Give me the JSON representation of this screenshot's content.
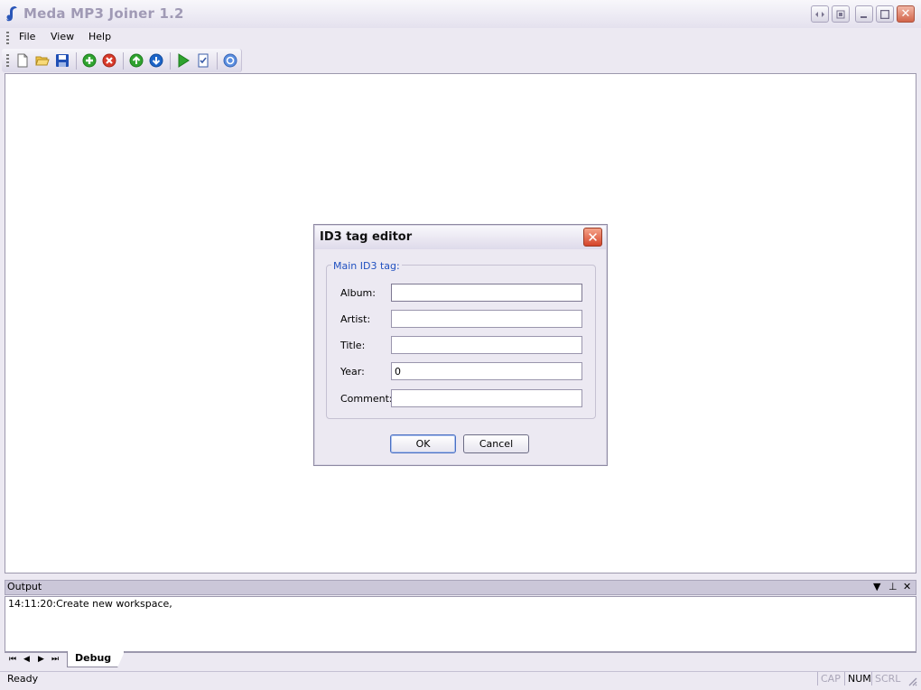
{
  "window": {
    "title": "Meda MP3 Joiner 1.2",
    "controls": {
      "close": "✕"
    }
  },
  "menu": {
    "items": [
      "File",
      "View",
      "Help"
    ]
  },
  "toolbar": {
    "tools": [
      "new-file",
      "open-folder",
      "save",
      "add",
      "remove",
      "move-up",
      "move-down",
      "play",
      "checklist",
      "help"
    ]
  },
  "dialog": {
    "title": "ID3 tag editor",
    "close": "✕",
    "group_label": "Main ID3 tag:",
    "fields": {
      "album": {
        "label": "Album:",
        "value": ""
      },
      "artist": {
        "label": "Artist:",
        "value": ""
      },
      "title": {
        "label": "Title:",
        "value": ""
      },
      "year": {
        "label": "Year:",
        "value": "0"
      },
      "comment": {
        "label": "Comment:",
        "value": ""
      }
    },
    "ok_label": "OK",
    "cancel_label": "Cancel"
  },
  "output": {
    "title": "Output",
    "lines": [
      "14:11:20:Create new workspace,"
    ],
    "controls": {
      "dropdown": "▼",
      "pin": "⊥",
      "close": "✕"
    }
  },
  "tabs": {
    "nav": {
      "first": "⏮",
      "prev": "◀",
      "next": "▶",
      "last": "⏭"
    },
    "items": [
      "Debug"
    ]
  },
  "status": {
    "text": "Ready",
    "indicators": {
      "cap": "CAP",
      "num": "NUM",
      "scrl": "SCRL"
    }
  },
  "colors": {
    "accent": "#2151c0",
    "close_red": "#d5442a",
    "toolbar_green": "#2fa32f",
    "toolbar_blue": "#1c64c8"
  }
}
